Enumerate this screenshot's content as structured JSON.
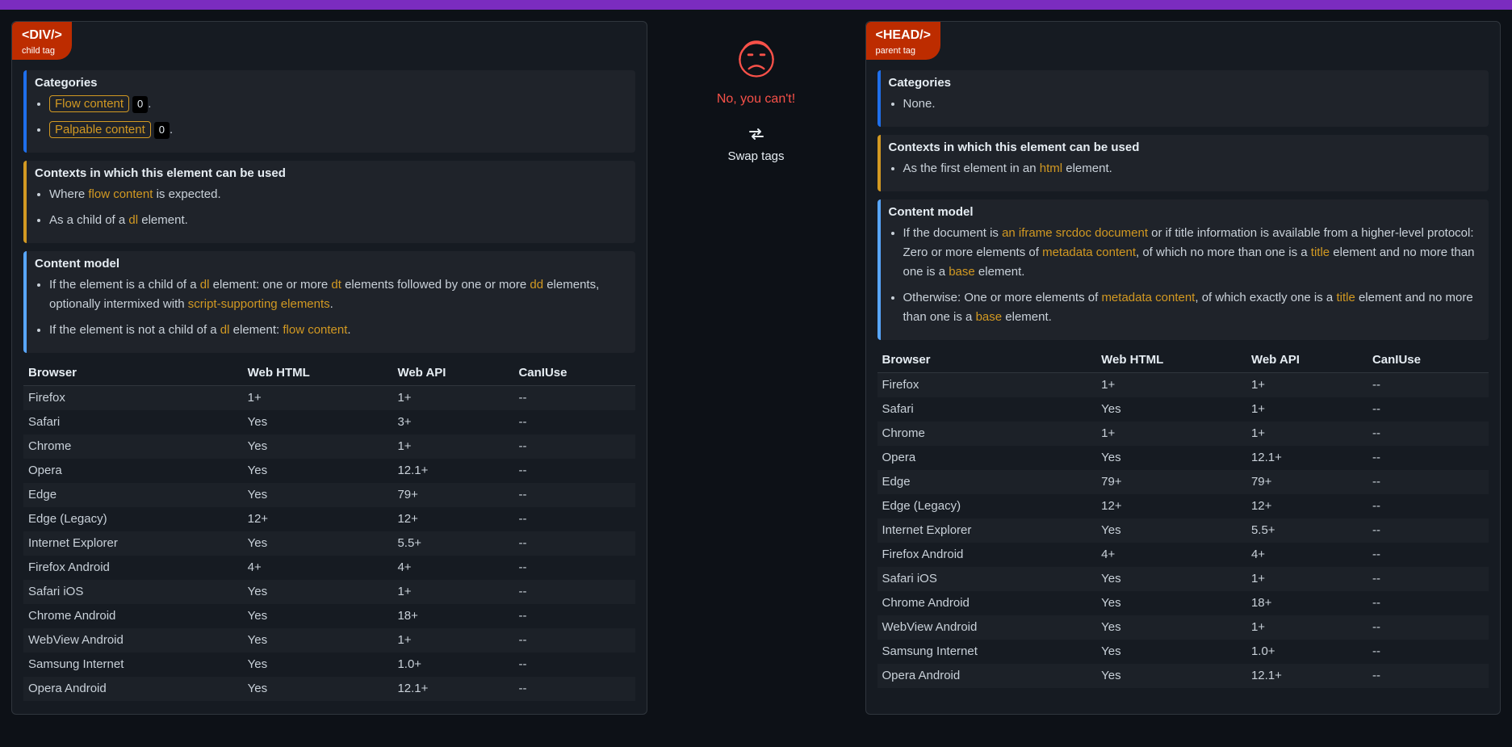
{
  "verdict_text": "No, you can't!",
  "swap_label": "Swap tags",
  "table_headers": {
    "browser": "Browser",
    "webhtml": "Web HTML",
    "webapi": "Web API",
    "caniuse": "CanIUse"
  },
  "left": {
    "tag_name": "<DIV/>",
    "tag_role": "child tag",
    "categories": {
      "title": "Categories",
      "items": [
        {
          "text": "Flow content",
          "count": "0",
          "suffix": "."
        },
        {
          "text": "Palpable content",
          "count": "0",
          "suffix": "."
        }
      ]
    },
    "contexts": {
      "title": "Contexts in which this element can be used",
      "items": [
        {
          "html": "Where <span class='lnk'>flow content</span> is expected."
        },
        {
          "html": "As a child of a <span class='lnk'>dl</span> element."
        }
      ]
    },
    "content_model": {
      "title": "Content model",
      "items": [
        {
          "html": "If the element is a child of a <span class='lnk'>dl</span> element: one or more <span class='lnk'>dt</span> elements followed by one or more <span class='lnk'>dd</span> elements, optionally intermixed with <span class='lnk'>script-supporting elements</span>."
        },
        {
          "html": "If the element is not a child of a <span class='lnk'>dl</span> element: <span class='lnk'>flow content</span>."
        }
      ]
    },
    "compat": [
      {
        "browser": "Firefox",
        "webhtml": "1+",
        "webapi": "1+",
        "caniuse": "--"
      },
      {
        "browser": "Safari",
        "webhtml": "Yes",
        "webapi": "3+",
        "caniuse": "--"
      },
      {
        "browser": "Chrome",
        "webhtml": "Yes",
        "webapi": "1+",
        "caniuse": "--"
      },
      {
        "browser": "Opera",
        "webhtml": "Yes",
        "webapi": "12.1+",
        "caniuse": "--"
      },
      {
        "browser": "Edge",
        "webhtml": "Yes",
        "webapi": "79+",
        "caniuse": "--"
      },
      {
        "browser": "Edge (Legacy)",
        "webhtml": "12+",
        "webapi": "12+",
        "caniuse": "--"
      },
      {
        "browser": "Internet Explorer",
        "webhtml": "Yes",
        "webapi": "5.5+",
        "caniuse": "--"
      },
      {
        "browser": "Firefox Android",
        "webhtml": "4+",
        "webapi": "4+",
        "caniuse": "--"
      },
      {
        "browser": "Safari iOS",
        "webhtml": "Yes",
        "webapi": "1+",
        "caniuse": "--"
      },
      {
        "browser": "Chrome Android",
        "webhtml": "Yes",
        "webapi": "18+",
        "caniuse": "--"
      },
      {
        "browser": "WebView Android",
        "webhtml": "Yes",
        "webapi": "1+",
        "caniuse": "--"
      },
      {
        "browser": "Samsung Internet",
        "webhtml": "Yes",
        "webapi": "1.0+",
        "caniuse": "--"
      },
      {
        "browser": "Opera Android",
        "webhtml": "Yes",
        "webapi": "12.1+",
        "caniuse": "--"
      }
    ]
  },
  "right": {
    "tag_name": "<HEAD/>",
    "tag_role": "parent tag",
    "categories": {
      "title": "Categories",
      "items": [
        {
          "plain": "None."
        }
      ]
    },
    "contexts": {
      "title": "Contexts in which this element can be used",
      "items": [
        {
          "html": "As the first element in an <span class='lnk'>html</span> element."
        }
      ]
    },
    "content_model": {
      "title": "Content model",
      "items": [
        {
          "html": "If the document is <span class='lnk'>an iframe srcdoc document</span> or if title information is available from a higher-level protocol: Zero or more elements of <span class='lnk'>metadata content</span>, of which no more than one is a <span class='lnk'>title</span> element and no more than one is a <span class='lnk'>base</span> element."
        },
        {
          "html": "Otherwise: One or more elements of <span class='lnk'>metadata content</span>, of which exactly one is a <span class='lnk'>title</span> element and no more than one is a <span class='lnk'>base</span> element."
        }
      ]
    },
    "compat": [
      {
        "browser": "Firefox",
        "webhtml": "1+",
        "webapi": "1+",
        "caniuse": "--"
      },
      {
        "browser": "Safari",
        "webhtml": "Yes",
        "webapi": "1+",
        "caniuse": "--"
      },
      {
        "browser": "Chrome",
        "webhtml": "1+",
        "webapi": "1+",
        "caniuse": "--"
      },
      {
        "browser": "Opera",
        "webhtml": "Yes",
        "webapi": "12.1+",
        "caniuse": "--"
      },
      {
        "browser": "Edge",
        "webhtml": "79+",
        "webapi": "79+",
        "caniuse": "--"
      },
      {
        "browser": "Edge (Legacy)",
        "webhtml": "12+",
        "webapi": "12+",
        "caniuse": "--"
      },
      {
        "browser": "Internet Explorer",
        "webhtml": "Yes",
        "webapi": "5.5+",
        "caniuse": "--"
      },
      {
        "browser": "Firefox Android",
        "webhtml": "4+",
        "webapi": "4+",
        "caniuse": "--"
      },
      {
        "browser": "Safari iOS",
        "webhtml": "Yes",
        "webapi": "1+",
        "caniuse": "--"
      },
      {
        "browser": "Chrome Android",
        "webhtml": "Yes",
        "webapi": "18+",
        "caniuse": "--"
      },
      {
        "browser": "WebView Android",
        "webhtml": "Yes",
        "webapi": "1+",
        "caniuse": "--"
      },
      {
        "browser": "Samsung Internet",
        "webhtml": "Yes",
        "webapi": "1.0+",
        "caniuse": "--"
      },
      {
        "browser": "Opera Android",
        "webhtml": "Yes",
        "webapi": "12.1+",
        "caniuse": "--"
      }
    ]
  }
}
